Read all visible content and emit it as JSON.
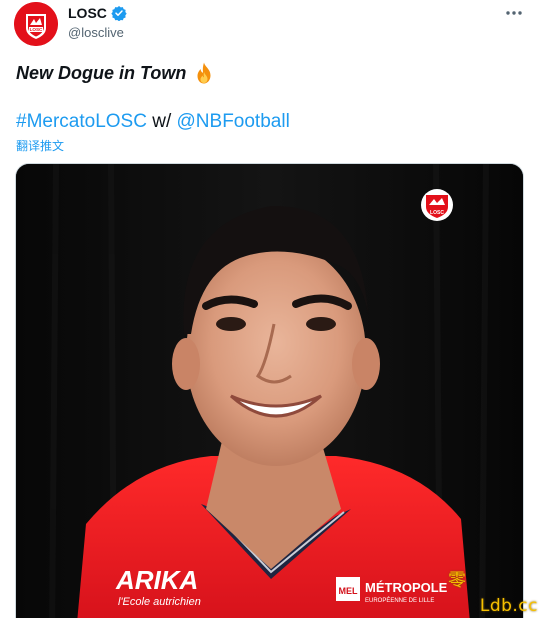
{
  "author": {
    "display_name": "LOSC",
    "handle": "@losclive",
    "avatar_text": "LOSC",
    "verified": true
  },
  "tweet": {
    "line1": "New Dogue in Town",
    "hashtag": "#MercatoLOSC",
    "connector": " w/ ",
    "mention": "@NBFootball",
    "translate_label": "翻译推文"
  },
  "media": {
    "corner_logo_text": "LOSC",
    "sponsor_left": "ARIKA",
    "sponsor_left_sub": "l'Ecole autrichien",
    "sponsor_right_badge": "MEL",
    "sponsor_right": "MÉTROPOLE",
    "sponsor_right_sub": "EUROPÉENNE DE LILLE"
  },
  "watermark": {
    "text": "Ldb.cc",
    "glyph": "零"
  },
  "colors": {
    "brand_red": "#e3101a",
    "link_blue": "#1d9bf0",
    "verified_blue": "#1d9bf0",
    "watermark_yellow": "#f6c000"
  },
  "icons": {
    "more": "more-horizontal-icon",
    "verified": "verified-badge-icon",
    "fire": "fire-emoji-icon"
  }
}
